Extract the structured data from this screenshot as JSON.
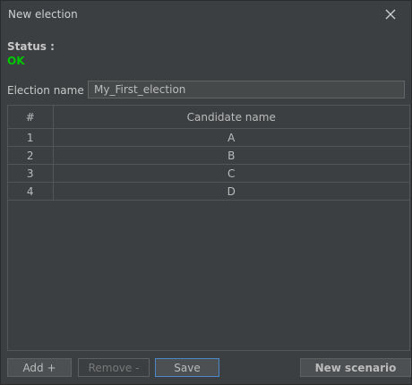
{
  "window": {
    "title": "New election"
  },
  "status": {
    "label": "Status :",
    "value": "OK",
    "color": "#00c800"
  },
  "election": {
    "label": "Election name :",
    "value": "My_First_election"
  },
  "table": {
    "columns": [
      "#",
      "Candidate name"
    ],
    "rows": [
      [
        "1",
        "A"
      ],
      [
        "2",
        "B"
      ],
      [
        "3",
        "C"
      ],
      [
        "4",
        "D"
      ]
    ]
  },
  "buttons": {
    "add": "Add +",
    "remove": "Remove -",
    "save": "Save",
    "new_scenario": "New scenario"
  },
  "icons": {
    "close": "close-icon"
  },
  "colors": {
    "background": "#3c3f41",
    "accent_focus": "#4a88c7",
    "status_ok": "#00c800"
  }
}
